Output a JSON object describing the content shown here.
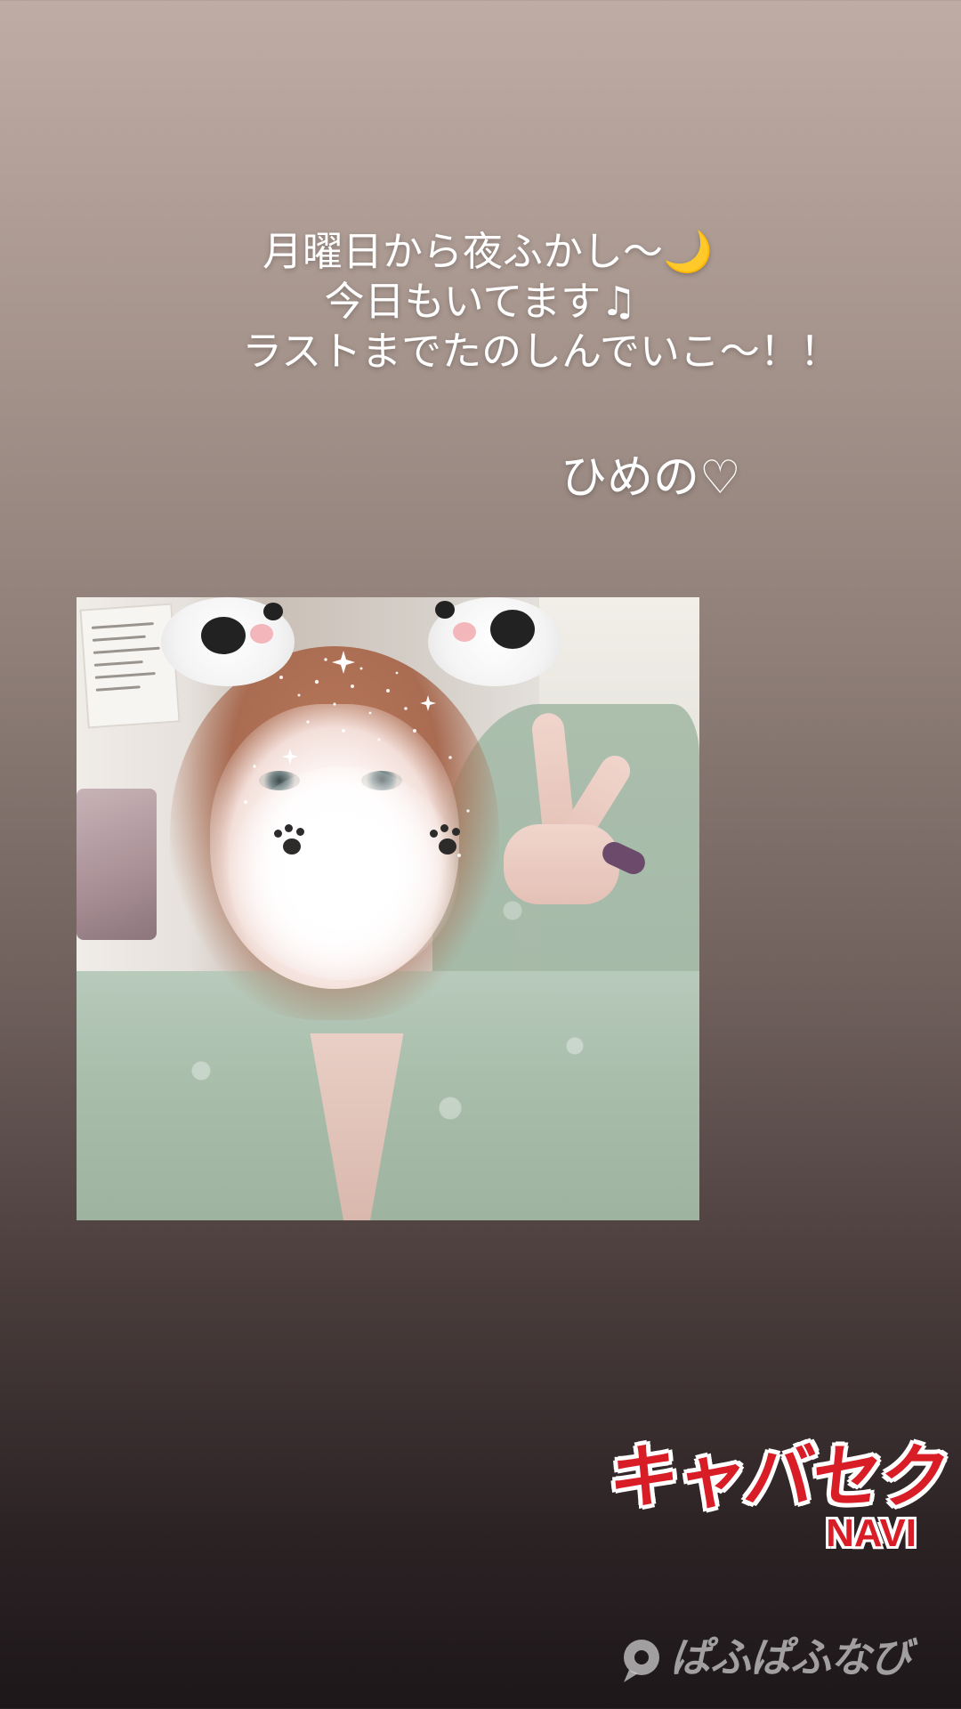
{
  "story": {
    "lines": [
      "月曜日から夜ふかし〜🌙",
      "今日もいてます♫",
      "ラストまでたのしんでいこ〜！！"
    ],
    "signature": "ひめの♡"
  },
  "watermarks": {
    "brand_main": "キャバセク",
    "brand_sub": "NAVI",
    "secondary": "ぱふぱふなび"
  },
  "colors": {
    "brand_red": "#d81d26",
    "text": "#ffffff"
  },
  "icons": {
    "moon": "crescent-moon-icon",
    "music": "music-note-icon",
    "secondary_logo": "speech-bubble-logo-icon"
  }
}
